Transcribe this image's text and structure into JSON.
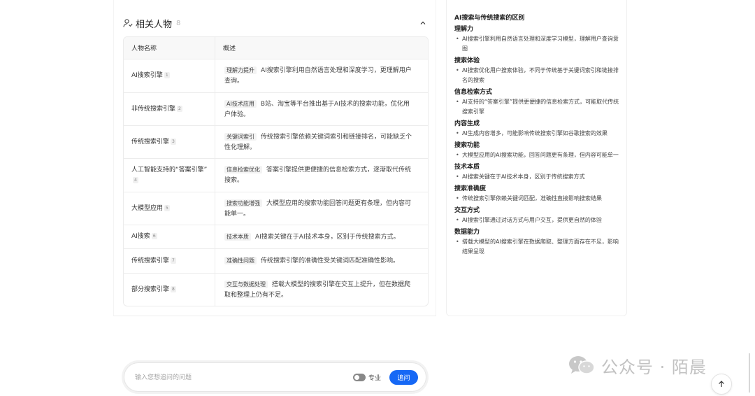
{
  "section": {
    "title": "相关人物",
    "count": "8"
  },
  "table": {
    "headers": [
      "人物名称",
      "概述"
    ],
    "rows": [
      {
        "name": "AI搜索引擎",
        "ref": "1",
        "tag": "理解力提升",
        "desc": "AI搜索引擎利用自然语言处理和深度学习，更理解用户查询。"
      },
      {
        "name": "非传统搜索引擎",
        "ref": "2",
        "tag": "AI技术应用",
        "desc": "B站、淘宝等平台推出基于AI技术的搜索功能，优化用户体验。"
      },
      {
        "name": "传统搜索引擎",
        "ref": "3",
        "tag": "关键词索引",
        "desc": "传统搜索引擎依赖关键词索引和链接排名，可能缺乏个性化理解。"
      },
      {
        "name": "人工智能支持的“答案引擎”",
        "ref": "4",
        "tag": "信息检索优化",
        "desc": "答案引擎提供更便捷的信息检索方式，逐渐取代传统搜索。"
      },
      {
        "name": "大模型应用",
        "ref": "5",
        "tag": "搜索功能增强",
        "desc": "大模型应用的搜索功能回答问题更有条理，但内容可能单一。"
      },
      {
        "name": "AI搜索",
        "ref": "6",
        "tag": "技术本质",
        "desc": "AI搜索关键在于AI技术本身，区别于传统搜索方式。"
      },
      {
        "name": "传统搜索引擎",
        "ref": "7",
        "tag": "准确性问题",
        "desc": "传统搜索引擎的准确性受关键词匹配准确性影响。"
      },
      {
        "name": "部分搜索引擎",
        "ref": "8",
        "tag": "交互与数据处理",
        "desc": "搭载大模型的搜索引擎在交互上提升，但在数据爬取和整理上仍有不足。"
      }
    ]
  },
  "summary": {
    "title": "AI搜索与传统搜索的区别",
    "sections": [
      {
        "heading": "理解力",
        "text": "AI搜索引擎利用自然语言处理和深度学习模型，理解用户查询意图"
      },
      {
        "heading": "搜索体验",
        "text": "AI搜索优化用户搜索体验，不同于传统基于关键词索引和链接排名的搜索"
      },
      {
        "heading": "信息检索方式",
        "text": "AI支持的“答案引擎”提供更便捷的信息检索方式，可能取代传统搜索引擎"
      },
      {
        "heading": "内容生成",
        "text": "AI生成内容增多，可能影响传统搜索引擎如谷歌搜索的效果"
      },
      {
        "heading": "搜索功能",
        "text": "大模型应用的AI搜索功能，回答问题更有条理，但内容可能单一"
      },
      {
        "heading": "技术本质",
        "text": "AI搜索关键在于AI技术本身，区别于传统搜索方式"
      },
      {
        "heading": "搜索准确度",
        "text": "传统搜索引擎依赖关键词匹配，准确性直接影响搜索结果"
      },
      {
        "heading": "交互方式",
        "text": "AI搜索引擎通过对话方式与用户交互，提供更自然的体验"
      },
      {
        "heading": "数据能力",
        "text": "搭载大模型的AI搜索引擎在数据爬取、整理方面存在不足，影响结果呈现"
      }
    ]
  },
  "input": {
    "placeholder": "输入您想追问的问题",
    "toggle_label": "专业",
    "submit_label": "追问"
  },
  "watermark": {
    "text": "公众号 · 陌晨"
  },
  "icons": {
    "section": "people-icon",
    "collapse": "chevron-up-icon",
    "scroll_top": "arrow-up-icon",
    "watermark": "wechat-icon"
  },
  "colors": {
    "accent": "#1668f5",
    "watermark": "#c2c2c2"
  }
}
